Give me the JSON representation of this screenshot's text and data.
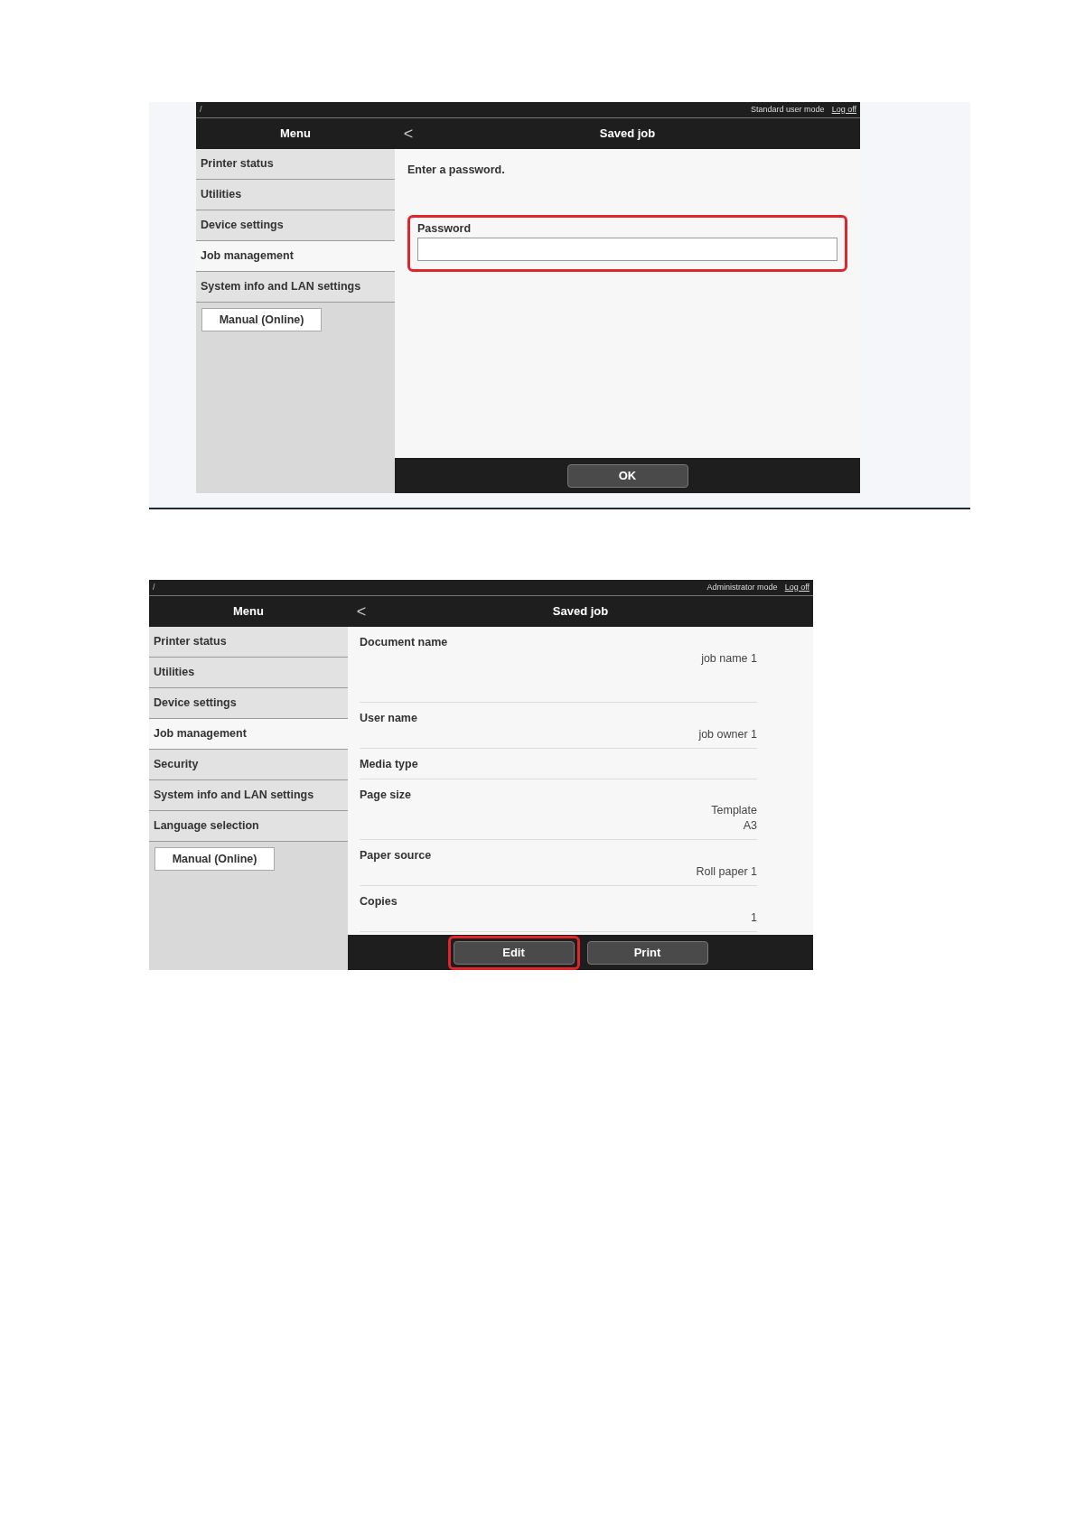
{
  "screens": [
    {
      "kind": "password",
      "path": "/",
      "mode": "Standard user mode",
      "logoff": "Log off",
      "menu_title": "Menu",
      "back": "<",
      "title": "Saved job",
      "sidebar": [
        {
          "label": "Printer status",
          "selected": false
        },
        {
          "label": "Utilities",
          "selected": false
        },
        {
          "label": "Device settings",
          "selected": false
        },
        {
          "label": "Job management",
          "selected": true
        },
        {
          "label": "System info and LAN settings",
          "selected": false
        }
      ],
      "manual_button": "Manual (Online)",
      "prompt": "Enter a password.",
      "field": {
        "label": "Password",
        "highlighted": true
      },
      "buttons": [
        {
          "label": "OK",
          "highlighted": false
        }
      ]
    },
    {
      "kind": "details",
      "path": "/",
      "mode": "Administrator mode",
      "logoff": "Log off",
      "menu_title": "Menu",
      "back": "<",
      "title": "Saved job",
      "sidebar": [
        {
          "label": "Printer status",
          "selected": false
        },
        {
          "label": "Utilities",
          "selected": false
        },
        {
          "label": "Device settings",
          "selected": false
        },
        {
          "label": "Job management",
          "selected": true
        },
        {
          "label": "Security",
          "selected": false
        },
        {
          "label": "System info and LAN settings",
          "selected": false
        },
        {
          "label": "Language selection",
          "selected": false
        }
      ],
      "manual_button": "Manual (Online)",
      "details": [
        {
          "label": "Document name",
          "values": [
            "job name 1"
          ]
        },
        {
          "label": "User name",
          "values": [
            "job owner 1"
          ]
        },
        {
          "label": "Media type"
        },
        {
          "label": "Page size",
          "values": [
            "Template",
            "A3"
          ]
        },
        {
          "label": "Paper source",
          "values": [
            "Roll paper 1"
          ]
        },
        {
          "label": "Copies",
          "values": [
            "1"
          ]
        }
      ],
      "buttons": [
        {
          "label": "Edit",
          "highlighted": true
        },
        {
          "label": "Print",
          "highlighted": false
        }
      ]
    }
  ]
}
